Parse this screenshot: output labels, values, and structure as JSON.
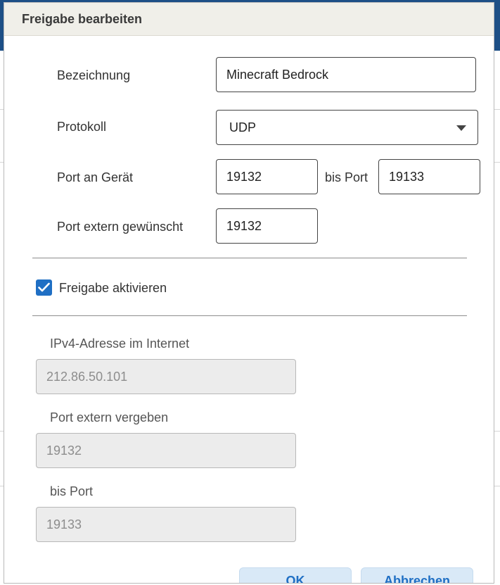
{
  "dialog": {
    "title": "Freigabe bearbeiten"
  },
  "form": {
    "name_label": "Bezeichnung",
    "name_value": "Minecraft Bedrock",
    "protocol_label": "Protokoll",
    "protocol_value": "UDP",
    "port_device_label": "Port an Gerät",
    "port_device_from": "19132",
    "to_port_label": "bis Port",
    "port_device_to": "19133",
    "port_external_label": "Port extern gewünscht",
    "port_external_value": "19132",
    "enable_label": "Freigabe aktivieren",
    "enable_checked": true
  },
  "info": {
    "ipv4_label": "IPv4-Adresse im Internet",
    "ipv4_value": "212.86.50.101",
    "port_assigned_label": "Port extern vergeben",
    "port_assigned_value": "19132",
    "to_port_label": "bis Port",
    "to_port_value": "19133"
  },
  "buttons": {
    "ok_label": "OK",
    "cancel_label": "Abbrechen"
  },
  "colors": {
    "accent": "#1f6fc4",
    "header_bg": "#f0efe9",
    "readonly_bg": "#ececec"
  }
}
